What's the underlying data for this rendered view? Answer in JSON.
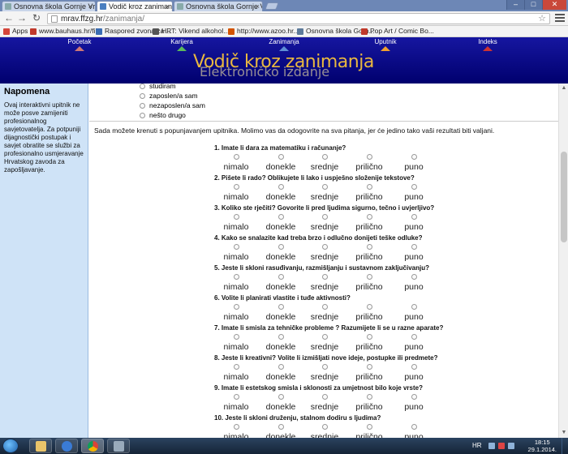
{
  "browser": {
    "tabs": [
      {
        "label": "Osnovna škola Gornje Vrap",
        "active": false
      },
      {
        "label": "Vodič kroz zanimanja",
        "active": true
      },
      {
        "label": "Osnovna škola Gornje Vrap",
        "active": false
      }
    ],
    "url_host": "mrav.ffzg.hr",
    "url_path": "/zanimanja/",
    "bookmarks": [
      {
        "label": "Apps",
        "color": "#d4453a"
      },
      {
        "label": "www.bauhaus.hr/fil...",
        "color": "#c0392b"
      },
      {
        "label": "Raspored zvona za ...",
        "color": "#3b6db3"
      },
      {
        "label": "HRT: Vikend alkohol...",
        "color": "#555555"
      },
      {
        "label": "http://www.azoo.hr...",
        "color": "#d35400"
      },
      {
        "label": "Osnovna škola Gorn...",
        "color": "#5d7a9a"
      },
      {
        "label": "Pop Art / Comic Bo...",
        "color": "#c0392b"
      }
    ]
  },
  "site": {
    "nav": [
      {
        "label": "Početak",
        "color": "#cc7777"
      },
      {
        "label": "Karijera",
        "color": "#5cb85c"
      },
      {
        "label": "Zanimanja",
        "color": "#5f8fd6"
      },
      {
        "label": "Uputnik",
        "color": "#f0a030"
      },
      {
        "label": "Indeks",
        "color": "#cc3333"
      }
    ],
    "title": "Vodič kroz zanimanja",
    "subtitle": "Elektroničko izdanje"
  },
  "sidebar": {
    "heading": "Napomena",
    "text": "Ovaj interaktivni upitnik ne može posve zamijeniti profesionalnog savjetovatelja. Za potpuniji dijagnostički postupak i savjet obratite se službi za profesionalno usmjeravanje Hrvatskog zavoda za zapošljavanje."
  },
  "status_options": [
    "studiram",
    "zaposlen/a sam",
    "nezaposlen/a sam",
    "nešto drugo"
  ],
  "intro": "Sada možete krenuti s popunjavanjem upitnika. Molimo vas da odogovrite na sva pitanja, jer će jedino tako vaši rezultati biti valjani.",
  "scale": [
    "nimalo",
    "donekle",
    "srednje",
    "prilično",
    "puno"
  ],
  "questions": [
    "1. Imate li dara za matematiku i računanje?",
    "2. Pišete li rado? Oblikujete li lako i uspješno složenije tekstove?",
    "3. Koliko ste rječiti? Govorite li pred ljudima sigurno, tečno i uvjerljivo?",
    "4. Kako se snalazite kad treba brzo i odlučno donijeti teške odluke?",
    "5. Jeste li skloni rasuđivanju, razmišljanju i sustavnom zaključivanju?",
    "6. Volite li planirati vlastite i tuđe aktivnosti?",
    "7. Imate li smisla za tehničke probleme ? Razumijete li se u razne aparate?",
    "8. Jeste li kreativni? Volite li izmišljati nove ideje, postupke ili predmete?",
    "9. Imate li estetskog smisla i sklonosti za umjetnost bilo koje vrste?",
    "10. Jeste li skloni druženju, stalnom dodiru s ljudima?"
  ],
  "taskbar": {
    "lang": "HR",
    "time": "18:15",
    "date": "29.1.2014."
  }
}
